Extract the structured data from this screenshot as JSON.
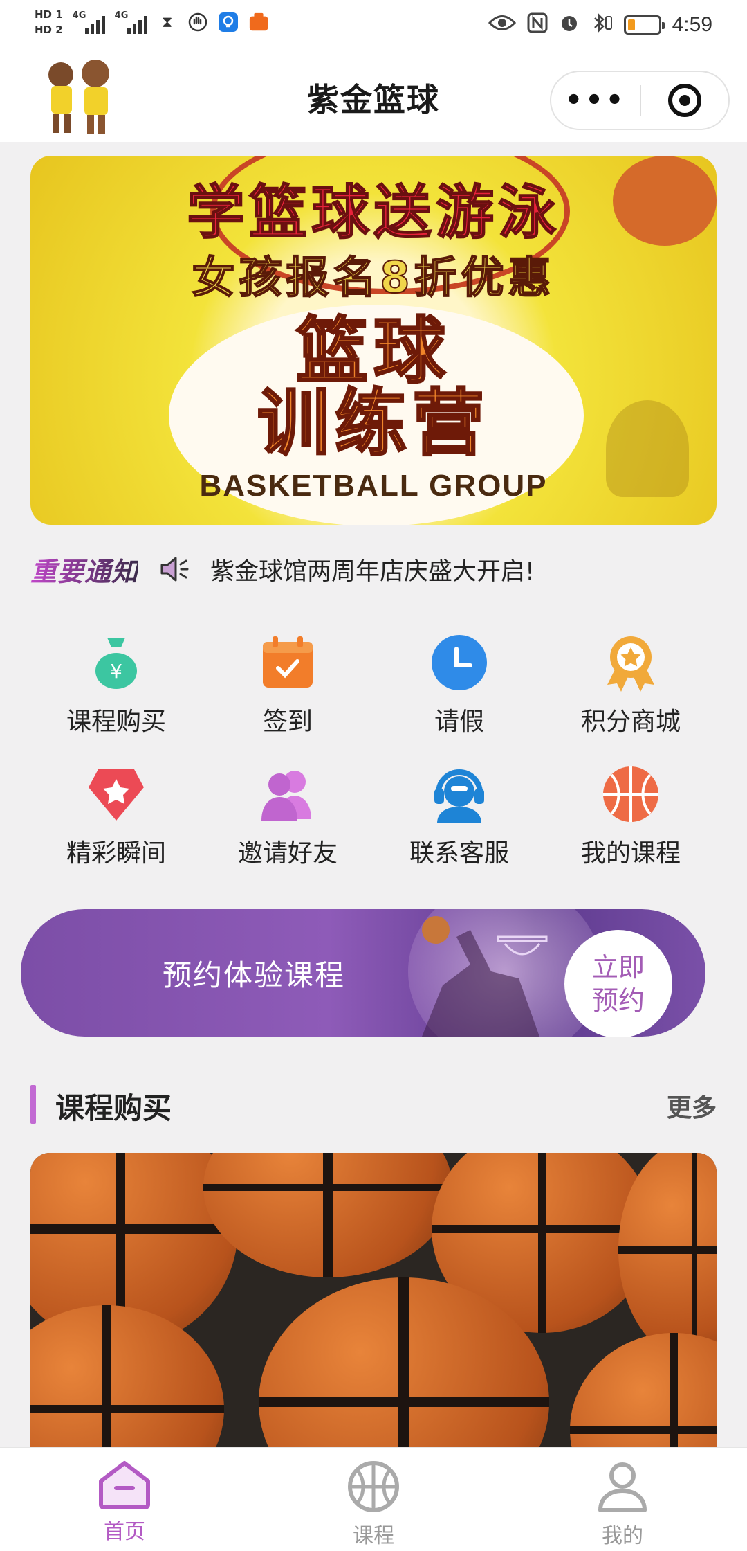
{
  "status_bar": {
    "sim1": "HD 1",
    "sim2": "HD 2",
    "net1": "4G",
    "net2": "4G",
    "time": "4:59",
    "battery_level": 0.25,
    "nfc": "N"
  },
  "title_bar": {
    "title": "紫金篮球",
    "more": "•••"
  },
  "banner": {
    "line1": "学篮球送游泳",
    "line2": "女孩报名8折优惠",
    "line3a": "篮球",
    "line3b": "训练营",
    "line4": "BASKETBALL GROUP"
  },
  "notice": {
    "tag": "重要通知",
    "text": "紫金球馆两周年店庆盛大开启!"
  },
  "grid": [
    {
      "label": "课程购买",
      "icon": "money-bag-icon"
    },
    {
      "label": "签到",
      "icon": "calendar-check-icon"
    },
    {
      "label": "请假",
      "icon": "clock-icon"
    },
    {
      "label": "积分商城",
      "icon": "medal-icon"
    },
    {
      "label": "精彩瞬间",
      "icon": "star-gem-icon"
    },
    {
      "label": "邀请好友",
      "icon": "friends-icon"
    },
    {
      "label": "联系客服",
      "icon": "headset-icon"
    },
    {
      "label": "我的课程",
      "icon": "basketball-icon"
    }
  ],
  "promo": {
    "text": "预约体验课程",
    "cta_line1": "立即",
    "cta_line2": "预约"
  },
  "section": {
    "title": "课程购买",
    "more": "更多"
  },
  "tabs": [
    {
      "label": "首页",
      "active": true
    },
    {
      "label": "课程",
      "active": false
    },
    {
      "label": "我的",
      "active": false
    }
  ],
  "colors": {
    "accent": "#b35ac4",
    "promo": "#8e5bb8"
  }
}
